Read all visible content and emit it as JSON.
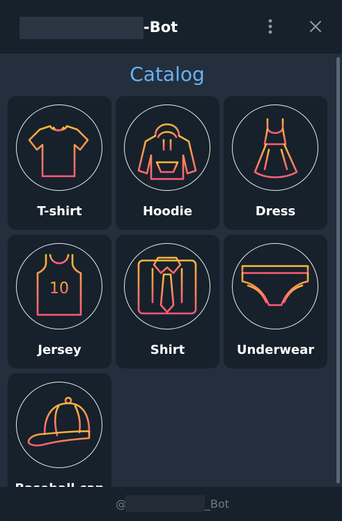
{
  "window": {
    "title_suffix": "-Bot",
    "menu_icon": "kebab-vertical-icon",
    "close_icon": "close-icon"
  },
  "catalog": {
    "heading": "Catalog",
    "items": [
      {
        "label": "T-shirt",
        "icon": "tshirt-icon"
      },
      {
        "label": "Hoodie",
        "icon": "hoodie-icon"
      },
      {
        "label": "Dress",
        "icon": "dress-icon"
      },
      {
        "label": "Jersey",
        "icon": "jersey-icon",
        "number": "10"
      },
      {
        "label": "Shirt",
        "icon": "shirt-icon"
      },
      {
        "label": "Underwear",
        "icon": "underwear-icon"
      },
      {
        "label": "Baseball cap",
        "icon": "cap-icon"
      }
    ]
  },
  "footer": {
    "prefix": "@",
    "suffix": "_Bot"
  },
  "colors": {
    "accent": "#6ab2f2",
    "icon_gradient_top": "#fdba3a",
    "icon_gradient_bottom": "#fd5a77",
    "tile_bg": "#17212b",
    "window_bg": "#242f3d"
  }
}
